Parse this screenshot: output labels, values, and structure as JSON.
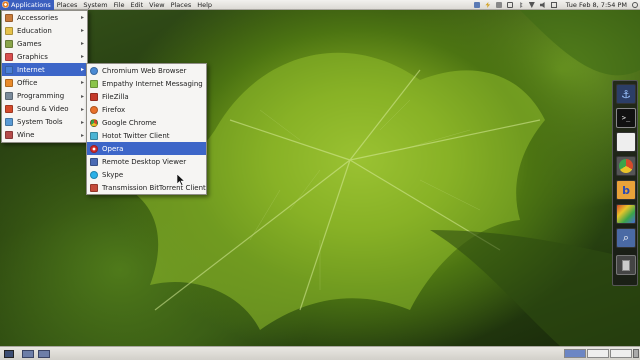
{
  "top_panel": {
    "menus": [
      "Applications",
      "Places",
      "System",
      "File",
      "Edit",
      "View",
      "Places",
      "Help"
    ],
    "clock": "Tue Feb 8,  7:54 PM"
  },
  "applications_menu": {
    "items": [
      {
        "label": "Accessories",
        "color": "#c97b3a"
      },
      {
        "label": "Education",
        "color": "#e6c24a"
      },
      {
        "label": "Games",
        "color": "#8aa54a"
      },
      {
        "label": "Graphics",
        "color": "#d94f4f"
      },
      {
        "label": "Internet",
        "color": "#4a7fd4"
      },
      {
        "label": "Office",
        "color": "#e88a2a"
      },
      {
        "label": "Programming",
        "color": "#7a8a9a"
      },
      {
        "label": "Sound & Video",
        "color": "#d44a2a"
      },
      {
        "label": "System Tools",
        "color": "#5a9ad4"
      },
      {
        "label": "Wine",
        "color": "#b44a4a"
      }
    ],
    "highlighted": "Internet"
  },
  "internet_submenu": {
    "items": [
      {
        "label": "Chromium Web Browser",
        "color": "#4a8ad4"
      },
      {
        "label": "Empathy Internet Messaging",
        "color": "#8ac44a"
      },
      {
        "label": "FileZilla",
        "color": "#c43a2a"
      },
      {
        "label": "Firefox",
        "color": "#e8702a"
      },
      {
        "label": "Google Chrome",
        "color": "#3aa44a"
      },
      {
        "label": "Hotot Twitter Client",
        "color": "#4ab4d4"
      },
      {
        "label": "Opera",
        "color": "#d42a2a"
      },
      {
        "label": "Remote Desktop Viewer",
        "color": "#4a6ab4"
      },
      {
        "label": "Skype",
        "color": "#2ab0e8"
      },
      {
        "label": "Transmission BitTorrent Client",
        "color": "#c44a3a"
      }
    ],
    "highlighted": "Opera"
  },
  "dock": {
    "items": [
      "anchor-icon",
      "terminal-icon",
      "text-editor-icon",
      "chrome-icon",
      "bluefish-icon",
      "paint-icon",
      "search-icon",
      "trash-icon"
    ]
  },
  "colors": {
    "highlight": "#3d66c8",
    "panel": "#dcdad5"
  }
}
